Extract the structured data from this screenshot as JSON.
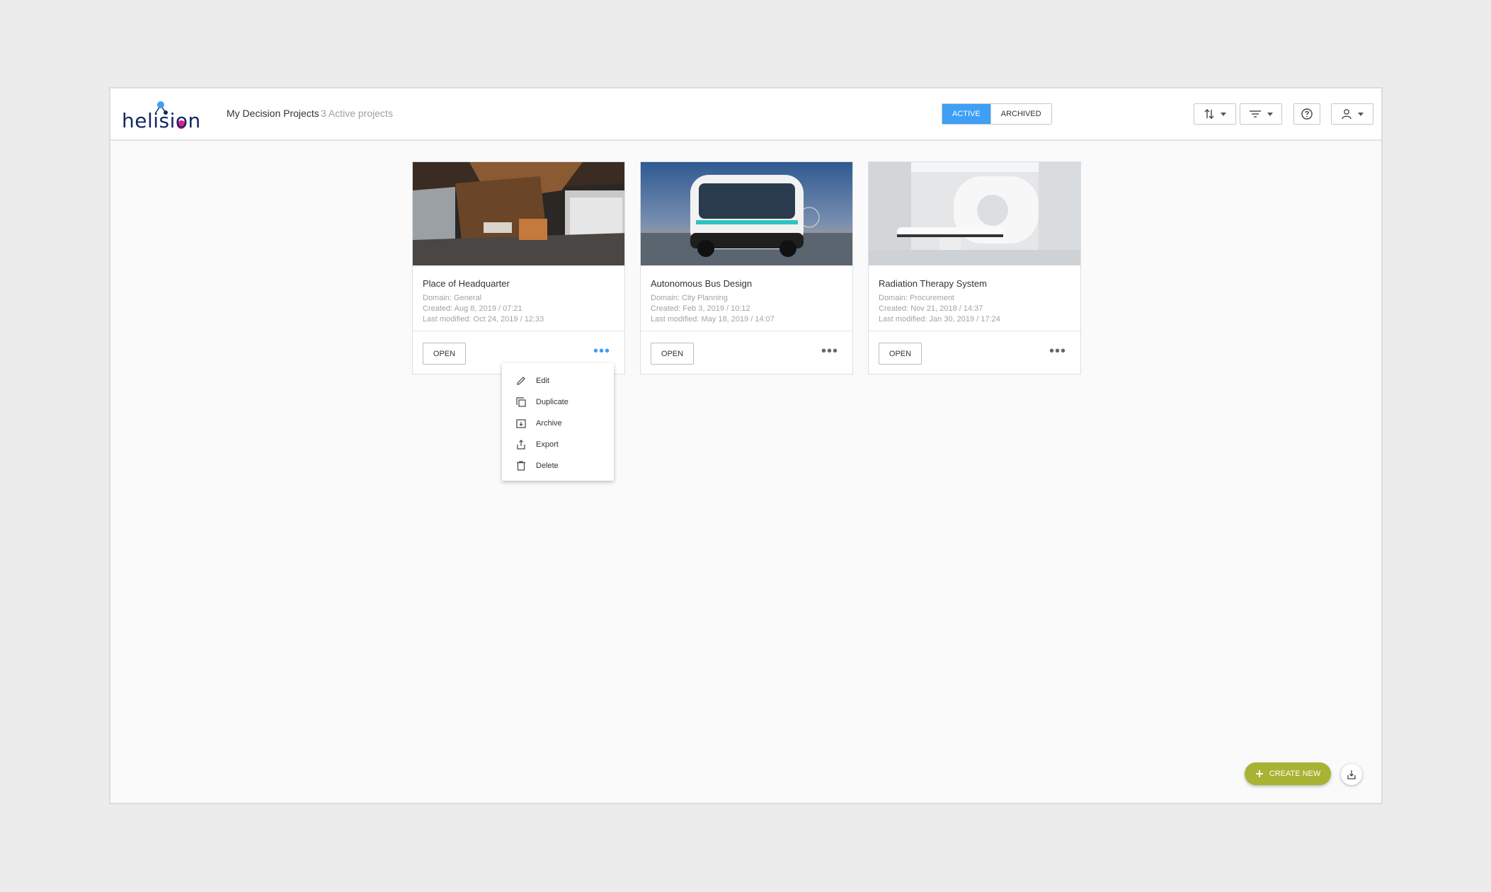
{
  "app": {
    "logo_text": "helision",
    "title": "My Decision Projects",
    "count_text": "3 Active projects"
  },
  "toolbar": {
    "tab_active": "ACTIVE",
    "tab_archived": "ARCHIVED",
    "sort_icon": "sort-icon",
    "filter_icon": "filter-icon",
    "help_icon": "help-icon",
    "user_icon": "user-icon"
  },
  "projects": [
    {
      "title": "Place of Headquarter",
      "domain": "Domain: General",
      "created": "Created: Aug 8, 2019 / 07:21",
      "modified": "Last modified: Oct 24, 2019 / 12:33",
      "open_label": "OPEN",
      "more_label": "•••"
    },
    {
      "title": "Autonomous Bus Design",
      "domain": "Domain: City Planning",
      "created": "Created: Feb 3, 2019 / 10:12",
      "modified": "Last modified: May 18, 2019 / 14:07",
      "open_label": "OPEN",
      "more_label": "•••"
    },
    {
      "title": "Radiation Therapy System",
      "domain": "Domain: Procurement",
      "created": "Created: Nov 21, 2018 / 14:37",
      "modified": "Last modified: Jan 30, 2019 / 17:24",
      "open_label": "OPEN",
      "more_label": "•••"
    }
  ],
  "context_menu": {
    "items": [
      "Edit",
      "Duplicate",
      "Archive",
      "Export",
      "Delete"
    ]
  },
  "actions": {
    "create_label": "CREATE NEW",
    "create_icon": "plus-icon",
    "download_icon": "download-icon"
  },
  "colors": {
    "accent": "#3d9ff5",
    "create": "#a8b333",
    "logo": "#152766",
    "logo_dot": "#e91e8c"
  }
}
